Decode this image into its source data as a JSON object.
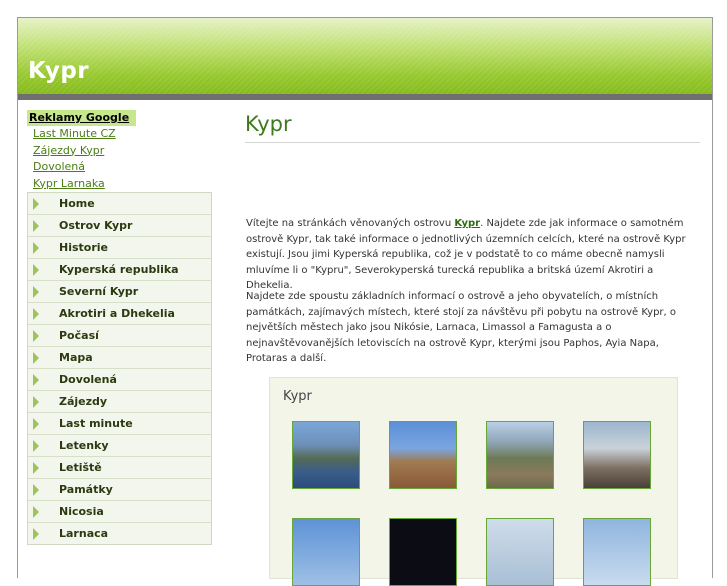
{
  "header": {
    "title": "Kypr"
  },
  "ads": {
    "title": "Reklamy Google",
    "links": [
      "Last Minute CZ",
      "Zájezdy Kypr",
      "Dovolená",
      "Kypr Larnaka"
    ]
  },
  "menu": [
    "Home",
    "Ostrov Kypr",
    "Historie",
    "Kyperská republika",
    "Severní Kypr",
    "Akrotiri a Dhekelia",
    "Počasí",
    "Mapa",
    "Dovolená",
    "Zájezdy",
    "Last minute",
    "Letenky",
    "Letiště",
    "Památky",
    "Nicosia",
    "Larnaca"
  ],
  "content": {
    "title": "Kypr",
    "p1_pre": "Vítejte na stránkách věnovaných ostrovu ",
    "p1_link": "Kypr",
    "p1_post": ". Najdete zde jak informace o samotném ostrově Kypr, tak také informace o jednotlivých územních celcích, které na ostrově Kypr existují. Jsou jimi Kyperská republika, což je v podstatě to co máme obecně namysli mluvíme li o \"Kypru\", Severokyperská turecká republika a britská území Akrotiri a Dhekelia.",
    "p2": "Najdete zde spoustu základních informací o ostrově a jeho obyvatelích, o místních památkách, zajímavých místech, které stojí za návštěvu při pobytu na ostrově Kypr, o největších městech jako jsou Nikósie, Larnaca, Limassol a Famagusta a o nejnavštěvovanějších letoviscích na ostrově Kypr, kterými jsou Paphos, Ayia Napa, Protaras a další.",
    "gallery_title": "Kypr"
  }
}
